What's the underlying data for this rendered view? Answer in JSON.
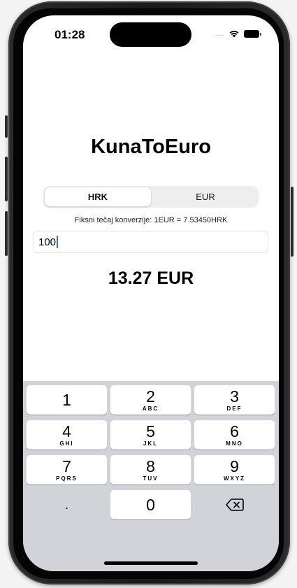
{
  "status_bar": {
    "time": "01:28",
    "signal_dots": "....",
    "wifi_icon": "wifi-icon",
    "battery_icon": "battery-icon"
  },
  "app": {
    "title": "KunaToEuro",
    "segments": [
      "HRK",
      "EUR"
    ],
    "selected_segment": "HRK",
    "rate_text": "Fiksni tečaj konverzije: 1EUR = 7.53450HRK",
    "input_value": "100",
    "result": "13.27 EUR"
  },
  "keyboard": {
    "keys": [
      {
        "digit": "1",
        "letters": ""
      },
      {
        "digit": "2",
        "letters": "ABC"
      },
      {
        "digit": "3",
        "letters": "DEF"
      },
      {
        "digit": "4",
        "letters": "GHI"
      },
      {
        "digit": "5",
        "letters": "JKL"
      },
      {
        "digit": "6",
        "letters": "MNO"
      },
      {
        "digit": "7",
        "letters": "PQRS"
      },
      {
        "digit": "8",
        "letters": "TUV"
      },
      {
        "digit": "9",
        "letters": "WXYZ"
      }
    ],
    "decimal": ".",
    "zero": "0",
    "delete_icon": "backspace-icon"
  },
  "colors": {
    "caret": "#2f6de1",
    "keyboard_bg": "#d1d3d9"
  }
}
